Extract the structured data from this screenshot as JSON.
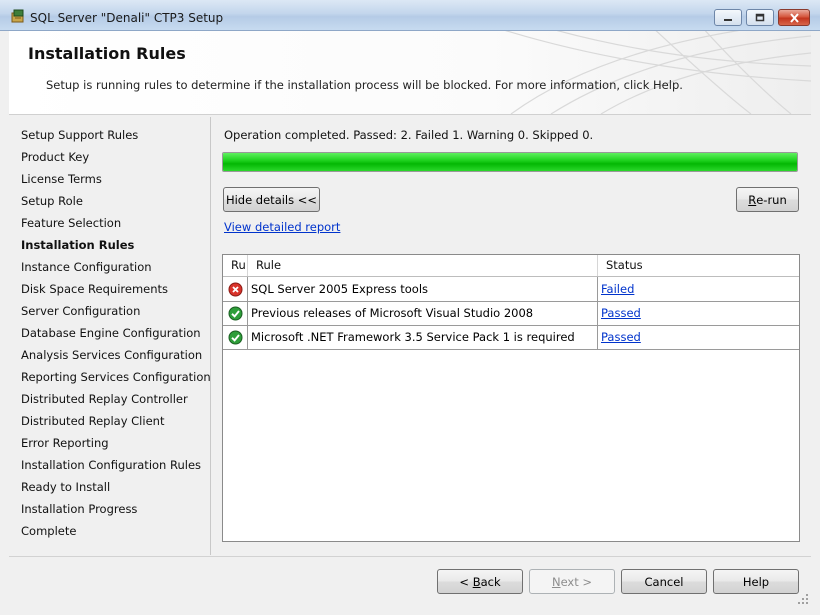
{
  "window": {
    "title": "SQL Server \"Denali\" CTP3 Setup"
  },
  "header": {
    "title": "Installation Rules",
    "description": "Setup is running rules to determine if the installation process will be blocked. For more information, click Help."
  },
  "sidebar": {
    "items": [
      {
        "label": "Setup Support Rules",
        "current": false
      },
      {
        "label": "Product Key",
        "current": false
      },
      {
        "label": "License Terms",
        "current": false
      },
      {
        "label": "Setup Role",
        "current": false
      },
      {
        "label": "Feature Selection",
        "current": false
      },
      {
        "label": "Installation Rules",
        "current": true
      },
      {
        "label": "Instance Configuration",
        "current": false
      },
      {
        "label": "Disk Space Requirements",
        "current": false
      },
      {
        "label": "Server Configuration",
        "current": false
      },
      {
        "label": "Database Engine Configuration",
        "current": false
      },
      {
        "label": "Analysis Services Configuration",
        "current": false
      },
      {
        "label": "Reporting Services Configuration",
        "current": false
      },
      {
        "label": "Distributed Replay Controller",
        "current": false
      },
      {
        "label": "Distributed Replay Client",
        "current": false
      },
      {
        "label": "Error Reporting",
        "current": false
      },
      {
        "label": "Installation Configuration Rules",
        "current": false
      },
      {
        "label": "Ready to Install",
        "current": false
      },
      {
        "label": "Installation Progress",
        "current": false
      },
      {
        "label": "Complete",
        "current": false
      }
    ]
  },
  "main": {
    "operation_status": "Operation completed. Passed: 2.   Failed 1.   Warning 0.   Skipped 0.",
    "progress": 1.0,
    "hide_details_label": "Hide details <<",
    "rerun_label": {
      "mnemonic": "R",
      "rest": "e-run"
    },
    "report_link": "View detailed report",
    "grid": {
      "columns": [
        "Ru",
        "Rule",
        "Status"
      ],
      "rows": [
        {
          "icon": "failed-icon",
          "rule": "SQL Server 2005 Express tools",
          "status": "Failed"
        },
        {
          "icon": "passed-icon",
          "rule": "Previous releases of Microsoft Visual Studio 2008",
          "status": "Passed"
        },
        {
          "icon": "passed-icon",
          "rule": "Microsoft .NET Framework 3.5 Service Pack 1 is required",
          "status": "Passed"
        }
      ]
    }
  },
  "footer": {
    "back": {
      "pre": "< ",
      "mnemonic": "B",
      "rest": "ack"
    },
    "next": {
      "mnemonic": "N",
      "rest": "ext >"
    },
    "cancel_label": "Cancel",
    "help_label": "Help",
    "next_enabled": false
  },
  "colors": {
    "progress_green": "#04b804",
    "link_blue": "#0033cc",
    "failed_red": "#d9332b",
    "passed_green": "#2e9e3a"
  }
}
